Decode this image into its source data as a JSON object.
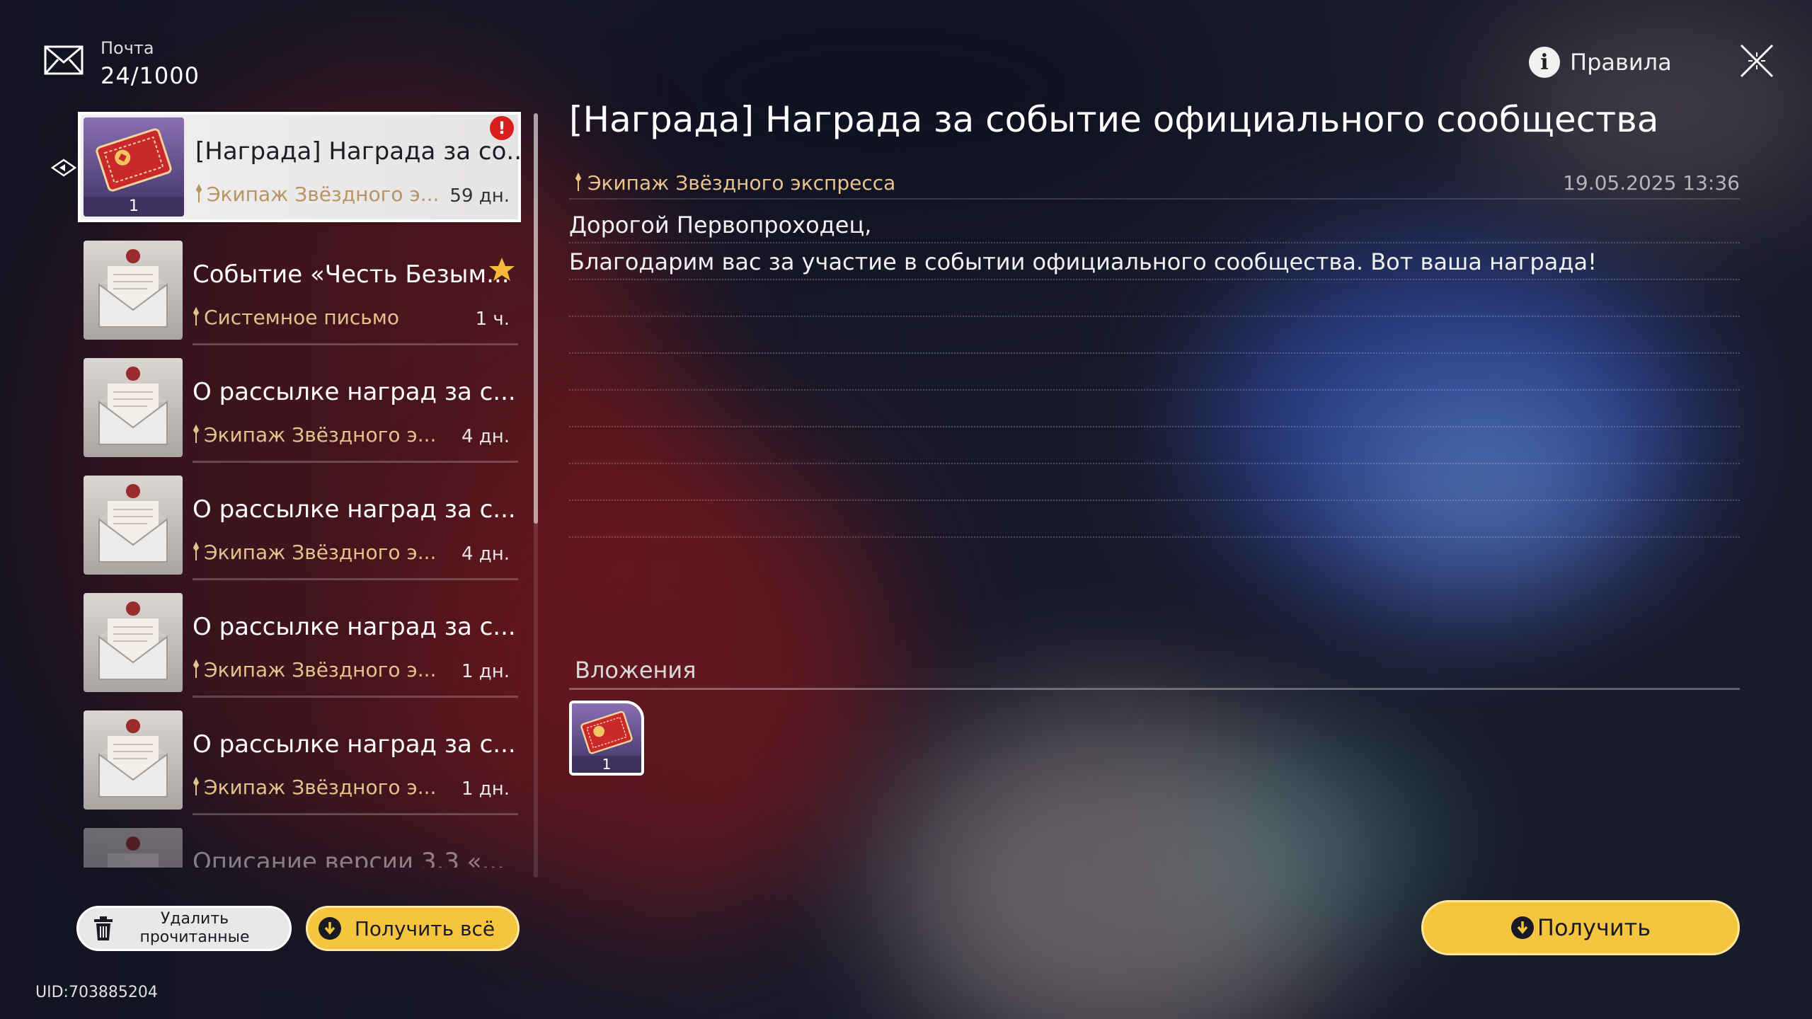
{
  "header": {
    "title": "Почта",
    "count": "24/1000",
    "rules_label": "Правила"
  },
  "mail_list": [
    {
      "title": "[Награда] Награда за со...",
      "sender": "Экипаж Звёздного э...",
      "age": "59 дн.",
      "attachment_count": "1",
      "selected": true,
      "alert": "!"
    },
    {
      "title": "Событие «Честь Безым...",
      "sender": "Системное письмо",
      "age": "1 ч.",
      "starred": true
    },
    {
      "title": "О рассылке наград за с...",
      "sender": "Экипаж Звёздного э...",
      "age": "4 дн."
    },
    {
      "title": "О рассылке наград за с...",
      "sender": "Экипаж Звёздного э...",
      "age": "4 дн."
    },
    {
      "title": "О рассылке наград за с...",
      "sender": "Экипаж Звёздного э...",
      "age": "1 дн."
    },
    {
      "title": "О рассылке наград за с...",
      "sender": "Экипаж Звёздного э...",
      "age": "1 дн."
    },
    {
      "title": "Описание версии 3.3 «...",
      "sender": "",
      "age": ""
    }
  ],
  "actions": {
    "delete_read": "Удалить прочитанные",
    "claim_all": "Получить всё",
    "claim": "Получить"
  },
  "uid": "UID:703885204",
  "detail": {
    "title": "[Награда] Награда за событие официального сообщества",
    "sender": "Экипаж Звёздного экспресса",
    "date": "19.05.2025 13:36",
    "body_lines": [
      "Дорогой Первопроходец,",
      "Благодарим вас за участие в событии официального сообщества. Вот ваша награда!",
      "",
      "",
      "",
      "",
      "",
      "",
      ""
    ],
    "attachments_label": "Вложения",
    "attachments": [
      {
        "count": "1"
      }
    ]
  },
  "colors": {
    "accent_yellow": "#f5c53f",
    "sender_gold": "#e3c28b",
    "alert_red": "#d81e1e"
  },
  "icons": [
    "mail-icon",
    "info-icon",
    "close-icon",
    "trash-icon",
    "download-icon",
    "star-icon",
    "alert-icon",
    "pin-icon",
    "ticket-icon"
  ]
}
